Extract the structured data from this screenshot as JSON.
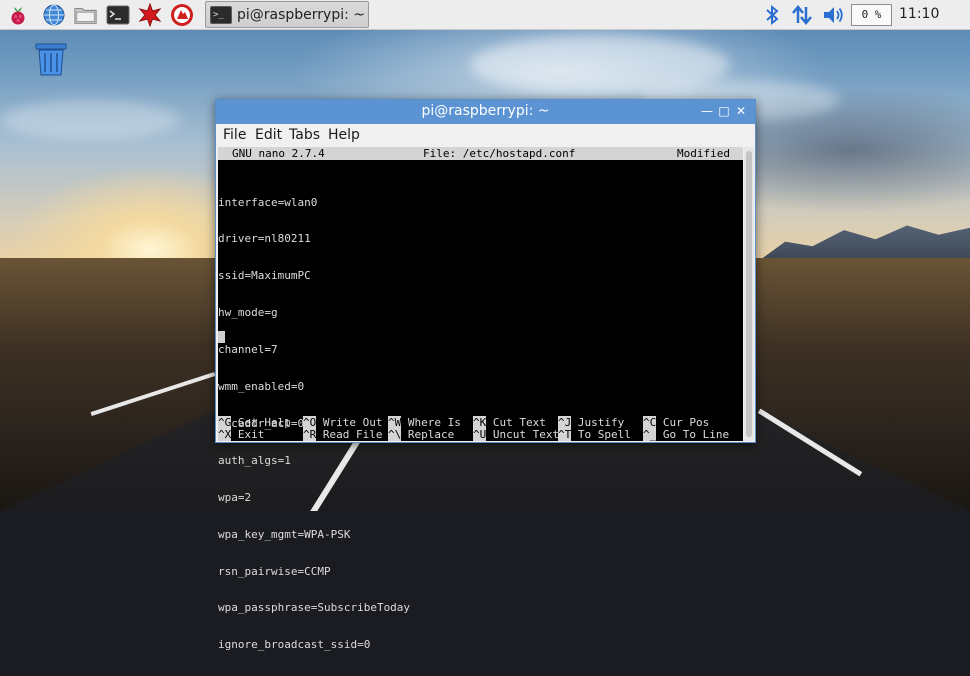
{
  "taskbar": {
    "launchers": [
      {
        "name": "raspberry-menu",
        "icon": "raspberry-icon"
      },
      {
        "name": "web-browser",
        "icon": "globe-icon"
      },
      {
        "name": "file-manager",
        "icon": "folder-icon"
      },
      {
        "name": "terminal",
        "icon": "terminal-icon"
      },
      {
        "name": "mathematica",
        "icon": "mathematica-icon"
      },
      {
        "name": "wolfram",
        "icon": "wolfram-icon"
      }
    ],
    "active_task": {
      "label": "pi@raspberrypi: ~",
      "icon": "terminal-icon"
    },
    "tray": {
      "cpu_usage": "0 %",
      "clock": "11:10",
      "icons": [
        "bluetooth-icon",
        "network-icon",
        "volume-icon"
      ]
    }
  },
  "desktop": {
    "icons": [
      {
        "name": "trash",
        "icon": "trash-icon"
      }
    ]
  },
  "window": {
    "title": "pi@raspberrypi: ~",
    "buttons": [
      "minimize",
      "maximize",
      "close"
    ],
    "menu": [
      "File",
      "Edit",
      "Tabs",
      "Help"
    ]
  },
  "nano": {
    "version": "GNU nano 2.7.4",
    "file": "File: /etc/hostapd.conf",
    "status": "Modified",
    "lines": [
      "interface=wlan0",
      "driver=nl80211",
      "ssid=MaximumPC",
      "hw_mode=g",
      "channel=7",
      "wmm_enabled=0",
      "macaddr_acl=0",
      "auth_algs=1",
      "wpa=2",
      "wpa_key_mgmt=WPA-PSK",
      "rsn_pairwise=CCMP",
      "wpa_passphrase=SubscribeToday",
      "ignore_broadcast_ssid=0"
    ],
    "shortcuts_row1": [
      {
        "key": "^G",
        "label": "Get Help"
      },
      {
        "key": "^O",
        "label": "Write Out"
      },
      {
        "key": "^W",
        "label": "Where Is"
      },
      {
        "key": "^K",
        "label": "Cut Text"
      },
      {
        "key": "^J",
        "label": "Justify"
      },
      {
        "key": "^C",
        "label": "Cur Pos"
      }
    ],
    "shortcuts_row2": [
      {
        "key": "^X",
        "label": "Exit"
      },
      {
        "key": "^R",
        "label": "Read File"
      },
      {
        "key": "^\\",
        "label": "Replace"
      },
      {
        "key": "^U",
        "label": "Uncut Text"
      },
      {
        "key": "^T",
        "label": "To Spell"
      },
      {
        "key": "^_",
        "label": "Go To Line"
      }
    ]
  },
  "colors": {
    "titlebar": "#5b93d3",
    "panel": "#ededed",
    "terminal_bg": "#000000",
    "terminal_fg": "#dcdcdc"
  }
}
